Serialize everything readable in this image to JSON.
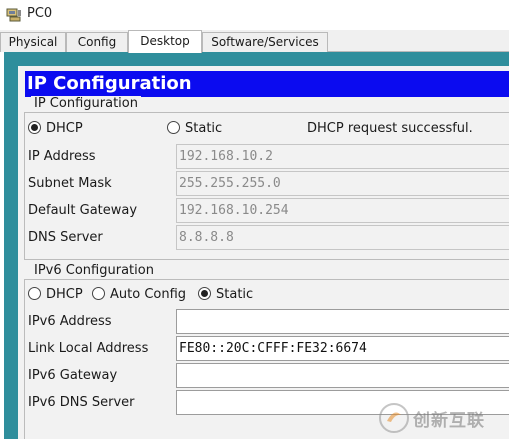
{
  "window": {
    "title": "PC0",
    "icon": "pc-icon"
  },
  "tabs": [
    {
      "label": "Physical",
      "active": false
    },
    {
      "label": "Config",
      "active": false
    },
    {
      "label": "Desktop",
      "active": true
    },
    {
      "label": "Software/Services",
      "active": false
    }
  ],
  "panel": {
    "header": "IP Configuration"
  },
  "ipv4": {
    "group_title": "IP Configuration",
    "dhcp_label": "DHCP",
    "static_label": "Static",
    "mode": "DHCP",
    "status": "DHCP request successful.",
    "fields": [
      {
        "label": "IP Address",
        "value": "192.168.10.2"
      },
      {
        "label": "Subnet Mask",
        "value": "255.255.255.0"
      },
      {
        "label": "Default Gateway",
        "value": "192.168.10.254"
      },
      {
        "label": "DNS Server",
        "value": "8.8.8.8"
      }
    ]
  },
  "ipv6": {
    "group_title": "IPv6 Configuration",
    "dhcp_label": "DHCP",
    "auto_label": "Auto Config",
    "static_label": "Static",
    "mode": "Static",
    "fields": [
      {
        "label": "IPv6 Address",
        "value": ""
      },
      {
        "label": "Link Local Address",
        "value": "FE80::20C:CFFF:FE32:6674"
      },
      {
        "label": "IPv6 Gateway",
        "value": ""
      },
      {
        "label": "IPv6 DNS Server",
        "value": ""
      }
    ]
  },
  "watermark": {
    "text": "创新互联"
  },
  "colors": {
    "header_bg": "#0b0bf0",
    "frame": "#2f8e9c",
    "panel_bg": "#f2f2f2"
  }
}
